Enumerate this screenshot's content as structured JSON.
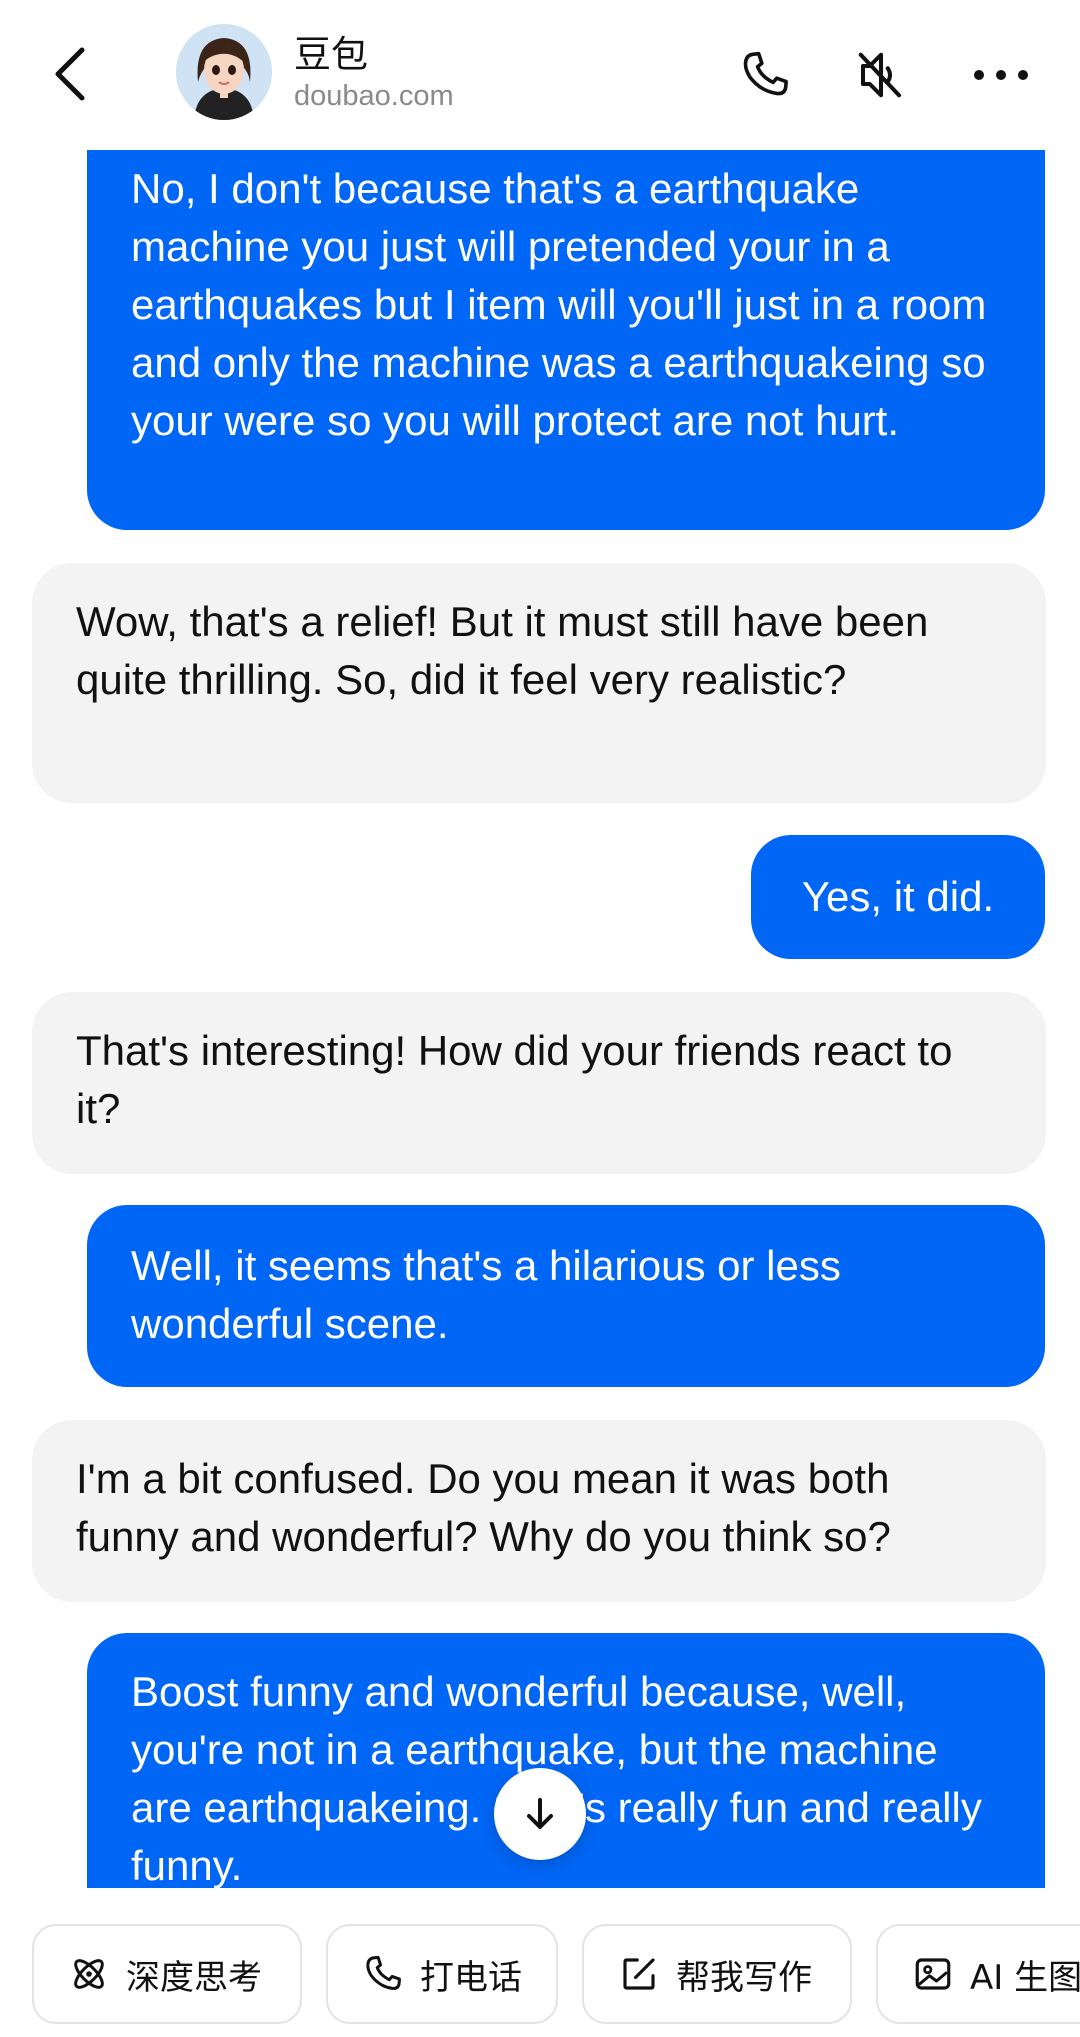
{
  "header": {
    "bot_name": "豆包",
    "bot_site": "doubao.com",
    "icons": [
      "back-arrow-icon",
      "phone-icon",
      "speaker-muted-icon",
      "more-icon"
    ]
  },
  "messages": [
    {
      "role": "user",
      "text": "No, I don't because that's a earthquake machine you just will pretended your in a earthquakes but I item will you'll just in a room and only the machine was a earthquakeing so your were so you will protect are not hurt."
    },
    {
      "role": "bot",
      "text": "Wow, that's a relief! But it must still have been quite thrilling. So, did it feel very realistic?"
    },
    {
      "role": "user",
      "text": "Yes, it did."
    },
    {
      "role": "bot",
      "text": "That's interesting! How did your friends react to it?"
    },
    {
      "role": "user",
      "text": "Well, it seems that's a hilarious or less wonderful scene."
    },
    {
      "role": "bot",
      "text": "I'm a bit confused. Do you mean it was both funny and wonderful? Why do you think so?"
    },
    {
      "role": "user",
      "text": "Boost funny and wonderful because, well, you're not in a earthquake, but the machine are earthquakeing. So it's really fun and really funny."
    }
  ],
  "chips": [
    {
      "label": "深度思考",
      "icon": "atom-icon"
    },
    {
      "label": "打电话",
      "icon": "phone-icon"
    },
    {
      "label": "帮我写作",
      "icon": "edit-icon"
    },
    {
      "label": "AI 生图",
      "icon": "image-icon"
    }
  ],
  "colors": {
    "user_bubble": "#0066f5",
    "bot_bubble": "#f3f3f3",
    "user_text": "#ffffff",
    "bot_text": "#111111"
  }
}
